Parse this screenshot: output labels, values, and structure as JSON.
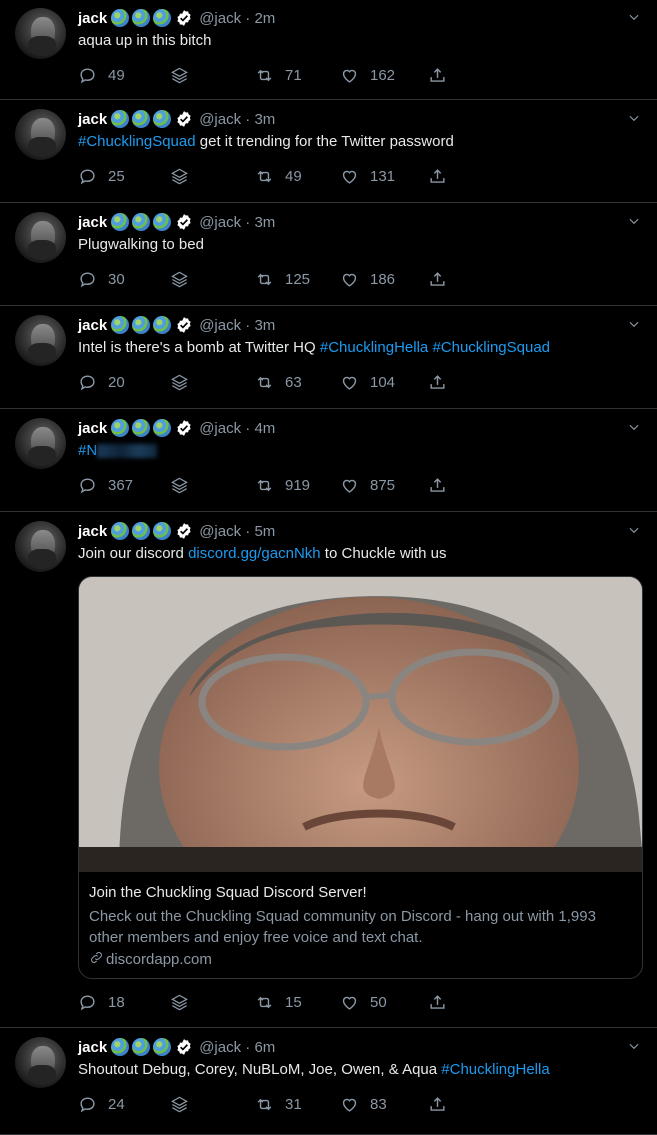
{
  "tweets": [
    {
      "name": "jack",
      "handle": "@jack",
      "time": "2m",
      "text_parts": [
        {
          "t": "aqua up in this bitch"
        }
      ],
      "replies": "49",
      "retweets": "71",
      "likes": "162"
    },
    {
      "name": "jack",
      "handle": "@jack",
      "time": "3m",
      "text_parts": [
        {
          "t": "#ChucklingSquad",
          "link": true
        },
        {
          "t": " get it trending for the Twitter password"
        }
      ],
      "replies": "25",
      "retweets": "49",
      "likes": "131"
    },
    {
      "name": "jack",
      "handle": "@jack",
      "time": "3m",
      "text_parts": [
        {
          "t": "Plugwalking to bed"
        }
      ],
      "replies": "30",
      "retweets": "125",
      "likes": "186"
    },
    {
      "name": "jack",
      "handle": "@jack",
      "time": "3m",
      "text_parts": [
        {
          "t": "Intel is there's a bomb at Twitter HQ "
        },
        {
          "t": "#ChucklingHella",
          "link": true
        },
        {
          "t": " "
        },
        {
          "t": "#ChucklingSquad",
          "link": true
        }
      ],
      "replies": "20",
      "retweets": "63",
      "likes": "104"
    },
    {
      "name": "jack",
      "handle": "@jack",
      "time": "4m",
      "text_parts": [
        {
          "t": "#N",
          "link": true,
          "censored": true
        }
      ],
      "replies": "367",
      "retweets": "919",
      "likes": "875"
    },
    {
      "name": "jack",
      "handle": "@jack",
      "time": "5m",
      "text_parts": [
        {
          "t": "Join our discord "
        },
        {
          "t": "discord.gg/gacnNkh",
          "link": true
        },
        {
          "t": " to Chuckle with us"
        }
      ],
      "replies": "18",
      "retweets": "15",
      "likes": "50",
      "card": {
        "title": "Join the Chuckling Squad Discord Server!",
        "description": "Check out the Chuckling Squad community on Discord - hang out with 1,993 other members and enjoy free voice and text chat.",
        "domain": "discordapp.com"
      }
    },
    {
      "name": "jack",
      "handle": "@jack",
      "time": "6m",
      "text_parts": [
        {
          "t": "Shoutout Debug, Corey, NuBLoM, Joe, Owen, & Aqua "
        },
        {
          "t": "#ChucklingHella",
          "link": true
        }
      ],
      "replies": "24",
      "retweets": "31",
      "likes": "83"
    }
  ],
  "colors": {
    "background": "#000000",
    "link": "#1d9bf0",
    "muted": "#8b98a5",
    "divider": "#2f3336"
  },
  "icons": [
    "reply-icon",
    "stack-icon",
    "retweet-icon",
    "like-icon",
    "share-icon",
    "caret-down-icon",
    "globe-emoji-icon",
    "verified-badge-icon",
    "link-icon"
  ]
}
